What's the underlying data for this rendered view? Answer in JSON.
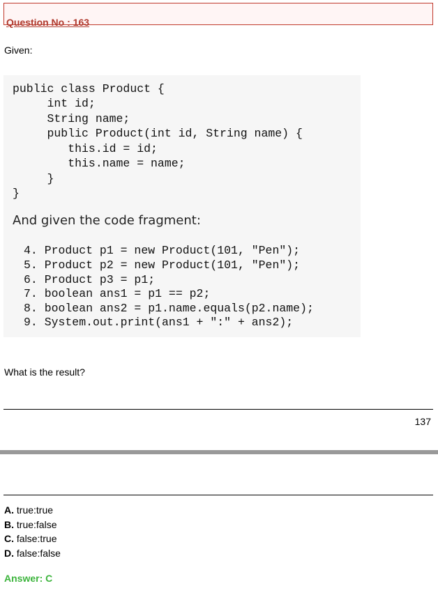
{
  "header": {
    "question_label": "Question No : 163"
  },
  "given_label": "Given:",
  "class_code": [
    "public class Product {",
    "     int id;",
    "     String name;",
    "     public Product(int id, String name) {",
    "        this.id = id;",
    "        this.name = name;",
    "     }",
    "}"
  ],
  "fragment_intro": "And given the code fragment:",
  "fragment_code": [
    "4. Product p1 = new Product(101, \"Pen\");",
    "5. Product p2 = new Product(101, \"Pen\");",
    "6. Product p3 = p1;",
    "7. boolean ans1 = p1 == p2;",
    "8. boolean ans2 = p1.name.equals(p2.name);",
    "9. System.out.print(ans1 + \":\" + ans2);"
  ],
  "question_text": "What is the result?",
  "page_number": "137",
  "options": [
    {
      "letter": "A.",
      "text": " true:true"
    },
    {
      "letter": "B.",
      "text": " true:false"
    },
    {
      "letter": "C.",
      "text": " false:true"
    },
    {
      "letter": "D.",
      "text": " false:false"
    }
  ],
  "answer": "Answer: C",
  "colors": {
    "question_title": "#b03a2e",
    "answer": "#3cb43c",
    "page_break": "#999999"
  }
}
